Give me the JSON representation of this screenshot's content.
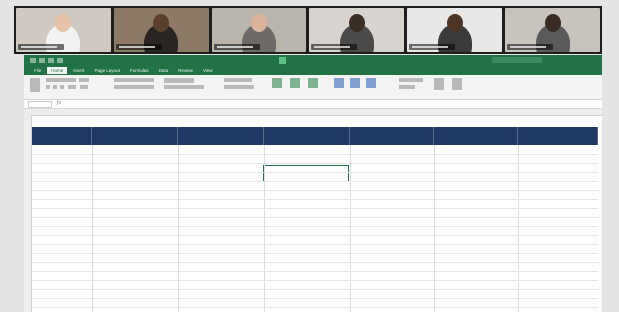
{
  "video_call": {
    "tiles": [
      {
        "bg": "#cfc9c2",
        "skin": "#e8c3a8",
        "shirt": "#f2f2f2"
      },
      {
        "bg": "#8a7a66",
        "skin": "#5a3f2c",
        "shirt": "#2a2522"
      },
      {
        "bg": "#b9b4ac",
        "skin": "#d9b39a",
        "shirt": "#6d6a68"
      },
      {
        "bg": "#d7d4cf",
        "skin": "#3b2e27",
        "shirt": "#4c4a48"
      },
      {
        "bg": "#e9e8e6",
        "skin": "#4b3423",
        "shirt": "#3a3a3a"
      },
      {
        "bg": "#c8c3bd",
        "skin": "#3a2b24",
        "shirt": "#5a5a5a"
      }
    ]
  },
  "excel": {
    "accent": "#217346",
    "header_fill": "#203864",
    "tabs": [
      {
        "label": "File"
      },
      {
        "label": "Home"
      },
      {
        "label": "Insert"
      },
      {
        "label": "Page Layout"
      },
      {
        "label": "Formulas"
      },
      {
        "label": "Data"
      },
      {
        "label": "Review"
      },
      {
        "label": "View"
      }
    ],
    "active_tab_index": 1
  }
}
